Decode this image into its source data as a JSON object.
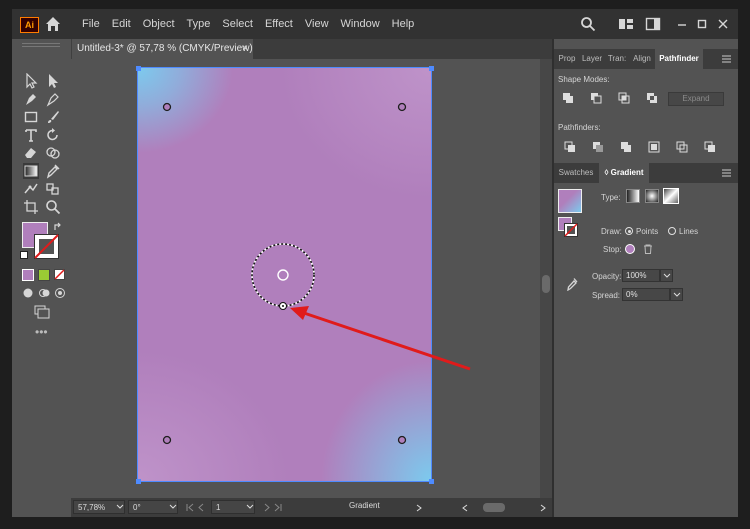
{
  "app": {
    "logo": "Ai"
  },
  "menu": [
    "File",
    "Edit",
    "Object",
    "Type",
    "Select",
    "Effect",
    "View",
    "Window",
    "Help"
  ],
  "document_tab": {
    "title": "Untitled-3* @ 57,78 % (CMYK/Preview)",
    "close": "×"
  },
  "statusbar": {
    "zoom": "57,78%",
    "rotation": "0°",
    "artboard": "1",
    "tool": "Gradient"
  },
  "panel_top": {
    "tabs": [
      "Prop",
      "Layer",
      "Tran:",
      "Align",
      "Pathfinder"
    ],
    "shape_modes_label": "Shape Modes:",
    "expand_label": "Expand",
    "pathfinders_label": "Pathfinders:"
  },
  "gradient_panel": {
    "tabs": [
      "Swatches",
      "Gradient"
    ],
    "type_label": "Type:",
    "draw_label": "Draw:",
    "draw_points": "Points",
    "draw_lines": "Lines",
    "stop_label": "Stop:",
    "opacity_label": "Opacity:",
    "opacity_value": "100%",
    "spread_label": "Spread:",
    "spread_value": "0%"
  },
  "toolbar": {
    "more": "•••"
  },
  "colors": {
    "accent": "#4e8bff",
    "fill": "#b07fbc",
    "gradient_edge": "#7ccaee",
    "arrow": "#e01b1b"
  }
}
